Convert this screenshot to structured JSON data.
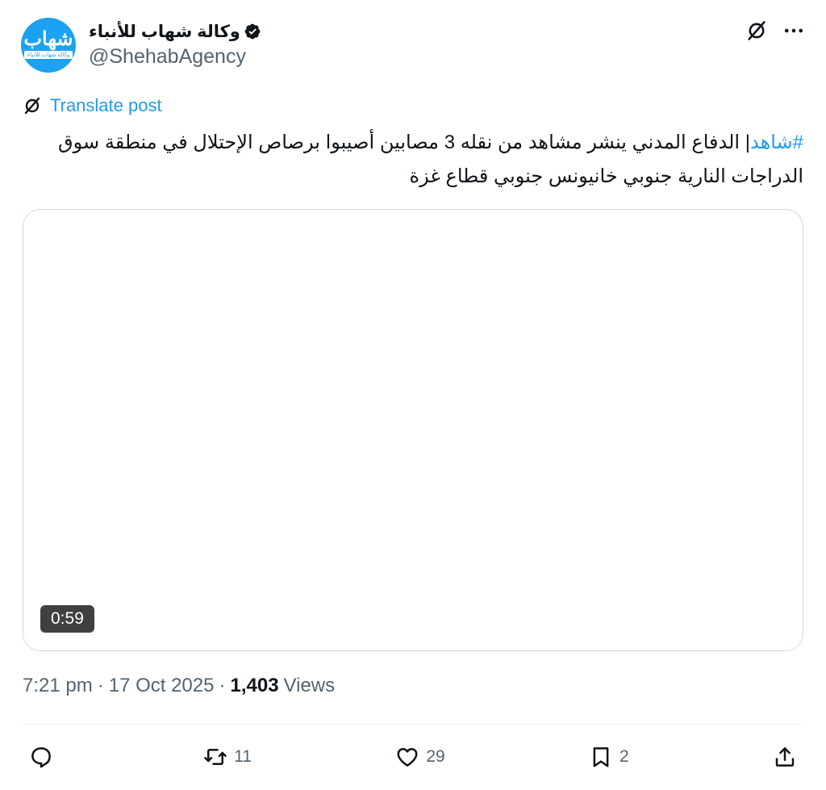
{
  "account": {
    "display_name": "وكالة شهاب للأنباء",
    "handle": "@ShehabAgency",
    "avatar_logo_text": "شهاب",
    "avatar_strip_text": "وكالة شهاب للأنباء",
    "verified": true
  },
  "header": {
    "icons": [
      "grok-icon",
      "more-icon"
    ]
  },
  "translate": {
    "label": "Translate post"
  },
  "tweet": {
    "hashtag": "#شاهد",
    "text": "| الدفاع المدني ينشر مشاهد من نقله 3 مصابين أصيبوا برصاص الإحتلال في منطقة سوق الدراجات النارية جنوبي خانيونس جنوبي قطاع غزة"
  },
  "media": {
    "duration": "0:59"
  },
  "meta": {
    "time": "7:21 pm",
    "separator": "·",
    "date": "17 Oct 2025",
    "views_count": "1,403",
    "views_label": "Views"
  },
  "actions": {
    "reply_count": "",
    "retweet_count": "11",
    "like_count": "29",
    "bookmark_count": "2"
  },
  "colors": {
    "accent": "#1d9bf0",
    "secondary_text": "#536471",
    "border": "#cfd9de"
  }
}
